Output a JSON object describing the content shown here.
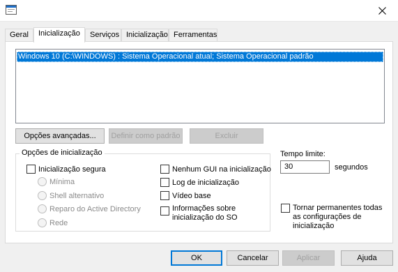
{
  "tabs": [
    "Geral",
    "Inicialização",
    "Serviços",
    "Inicialização",
    "Ferramentas"
  ],
  "boot_entries": [
    "Windows 10 (C:\\WINDOWS) : Sistema Operacional atual; Sistema Operacional padrão"
  ],
  "buttons": {
    "advanced": "Opções avançadas...",
    "set_default": "Definir como padrão",
    "delete": "Excluir",
    "ok": "OK",
    "cancel": "Cancelar",
    "apply": "Aplicar",
    "help": "Ajuda"
  },
  "boot_options": {
    "title": "Opções de inicialização",
    "safe_boot": "Inicialização segura",
    "minimal": "Mínima",
    "alternate_shell": "Shell alternativo",
    "ad_repair": "Reparo do Active Directory",
    "network": "Rede",
    "no_gui": "Nenhum GUI na inicialização",
    "boot_log": "Log de inicialização",
    "base_video": "Vídeo base",
    "os_info_line1": "Informações sobre",
    "os_info_line2": "inicialização do SO"
  },
  "timeout": {
    "label": "Tempo limite:",
    "value": "30",
    "unit": "segundos"
  },
  "permanent": {
    "line1": "Tornar permanentes todas",
    "line2": "as configurações de",
    "line3": "inicialização"
  },
  "colors": {
    "selection": "#0078d7",
    "disabled_text": "#a0a0a0"
  },
  "icons": {
    "app": "window-app-icon",
    "close": "close-icon"
  }
}
